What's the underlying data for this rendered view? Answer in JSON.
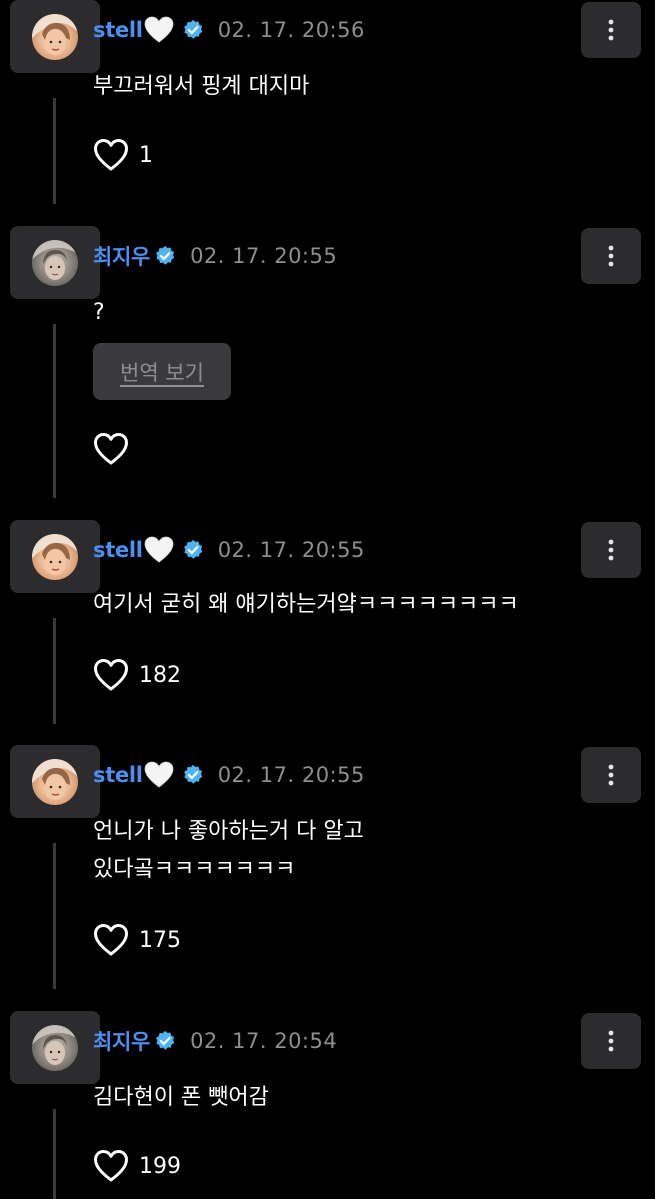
{
  "theme": {
    "background": "#000000",
    "username_color": "#4d8ff0",
    "verified_color": "#4fb3f0",
    "timestamp_color": "#8e8e93",
    "card_color": "#2c2c2e"
  },
  "comments": [
    {
      "username": "stell",
      "username_emoji": "white-heart",
      "verified": true,
      "timestamp": "02. 17. 20:56",
      "text": [
        "부끄러워서 핑계 대지마"
      ],
      "like_count": "1",
      "avatar": "avatar-stell"
    },
    {
      "username": "최지우",
      "verified": true,
      "timestamp": "02. 17. 20:55",
      "text": [
        "?"
      ],
      "translate_label": "번역 보기",
      "like_count": "",
      "avatar": "avatar-jiwoo"
    },
    {
      "username": "stell",
      "username_emoji": "white-heart",
      "verified": true,
      "timestamp": "02. 17. 20:55",
      "text": [
        "여기서 굳히 왜 얘기하는거얔ㅋㅋㅋㅋㅋㅋㅋㅋ"
      ],
      "like_count": "182",
      "avatar": "avatar-stell"
    },
    {
      "username": "stell",
      "username_emoji": "white-heart",
      "verified": true,
      "timestamp": "02. 17. 20:55",
      "text": [
        "언니가 나 좋아하는거 다 알고",
        "있다곸ㅋㅋㅋㅋㅋㅋㅋ"
      ],
      "like_count": "175",
      "avatar": "avatar-stell"
    },
    {
      "username": "최지우",
      "verified": true,
      "timestamp": "02. 17. 20:54",
      "text": [
        "김다현이 폰 뺏어감"
      ],
      "like_count": "199",
      "avatar": "avatar-jiwoo"
    }
  ]
}
